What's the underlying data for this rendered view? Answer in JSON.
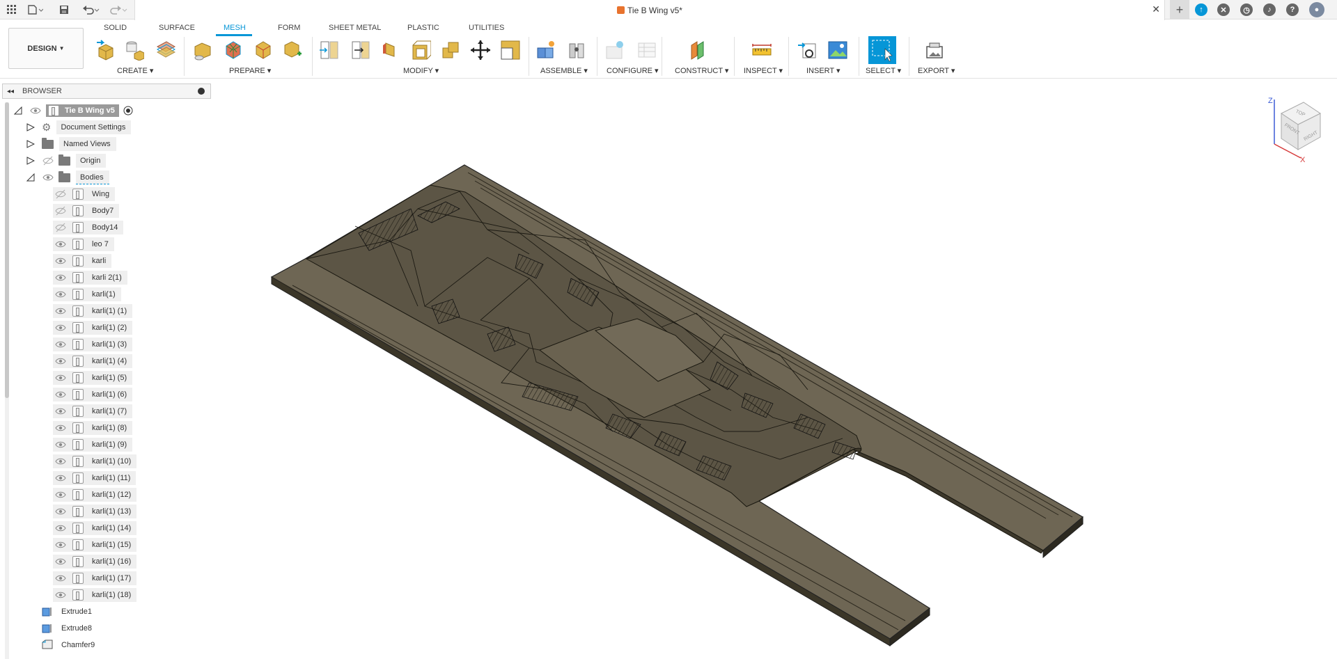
{
  "window": {
    "title": "Tie B Wing v5*"
  },
  "ribbon": {
    "workspace": "DESIGN",
    "tabs": [
      {
        "label": "SOLID",
        "active": false
      },
      {
        "label": "SURFACE",
        "active": false
      },
      {
        "label": "MESH",
        "active": true
      },
      {
        "label": "FORM",
        "active": false
      },
      {
        "label": "SHEET METAL",
        "active": false
      },
      {
        "label": "PLASTIC",
        "active": false
      },
      {
        "label": "UTILITIES",
        "active": false
      }
    ],
    "groups": [
      "CREATE ▾",
      "PREPARE ▾",
      "MODIFY ▾",
      "ASSEMBLE ▾",
      "CONFIGURE ▾",
      "CONSTRUCT ▾",
      "INSPECT ▾",
      "INSERT ▾",
      "SELECT ▾",
      "EXPORT ▾"
    ],
    "accent": "#0696d7"
  },
  "browser": {
    "header": "BROWSER",
    "root": "Tie B Wing v5",
    "folders": [
      {
        "label": "Document Settings",
        "icon": "gear-icon"
      },
      {
        "label": "Named Views",
        "icon": "folder-icon"
      },
      {
        "label": "Origin",
        "icon": "folder-icon"
      },
      {
        "label": "Bodies",
        "icon": "folder-icon"
      }
    ],
    "bodies": [
      {
        "label": "Wing",
        "visible": false
      },
      {
        "label": "Body7",
        "visible": false
      },
      {
        "label": "Body14",
        "visible": false
      },
      {
        "label": "leo 7",
        "visible": true
      },
      {
        "label": "karli",
        "visible": true
      },
      {
        "label": "karli 2(1)",
        "visible": true
      },
      {
        "label": "karli(1)",
        "visible": true
      },
      {
        "label": "karli(1) (1)",
        "visible": true
      },
      {
        "label": "karli(1) (2)",
        "visible": true
      },
      {
        "label": "karli(1) (3)",
        "visible": true
      },
      {
        "label": "karli(1) (4)",
        "visible": true
      },
      {
        "label": "karli(1) (5)",
        "visible": true
      },
      {
        "label": "karli(1) (6)",
        "visible": true
      },
      {
        "label": "karli(1) (7)",
        "visible": true
      },
      {
        "label": "karli(1) (8)",
        "visible": true
      },
      {
        "label": "karli(1) (9)",
        "visible": true
      },
      {
        "label": "karli(1) (10)",
        "visible": true
      },
      {
        "label": "karli(1) (11)",
        "visible": true
      },
      {
        "label": "karli(1) (12)",
        "visible": true
      },
      {
        "label": "karli(1) (13)",
        "visible": true
      },
      {
        "label": "karli(1) (14)",
        "visible": true
      },
      {
        "label": "karli(1) (15)",
        "visible": true
      },
      {
        "label": "karli(1) (16)",
        "visible": true
      },
      {
        "label": "karli(1) (17)",
        "visible": true
      },
      {
        "label": "karli(1) (18)",
        "visible": true
      }
    ],
    "features": [
      "Extrude1",
      "Extrude8",
      "Chamfer9"
    ]
  },
  "viewcube": {
    "faces": {
      "top": "TOP",
      "front": "FRONT",
      "right": "RIGHT"
    },
    "axes": {
      "z": "Z",
      "x": "X"
    }
  }
}
